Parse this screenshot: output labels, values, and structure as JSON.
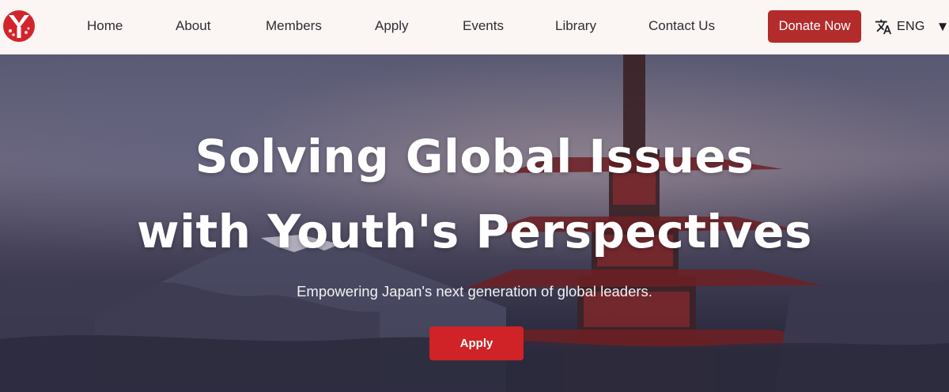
{
  "navbar": {
    "logo_icon": "youth-logo-icon",
    "links": [
      "Home",
      "About",
      "Members",
      "Apply",
      "Events",
      "Library",
      "Contact Us"
    ],
    "donate_label": "Donate Now",
    "language": {
      "icon": "translate-icon",
      "label": "ENG",
      "caret": "▼"
    }
  },
  "hero": {
    "title_line1": "Solving Global Issues",
    "title_line2": "with Youth's Perspectives",
    "subtitle": "Empowering Japan's next generation of global leaders.",
    "cta_label": "Apply"
  },
  "colors": {
    "brand_red": "#cf2327",
    "donate_red": "#b32b2b",
    "nav_bg": "#fbf5f4"
  }
}
